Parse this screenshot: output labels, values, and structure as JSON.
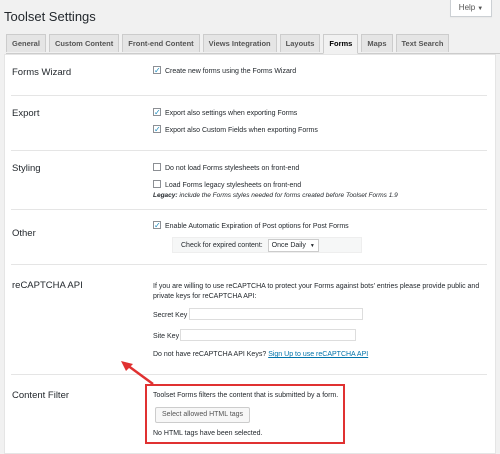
{
  "help": {
    "label": "Help"
  },
  "page": {
    "title": "Toolset Settings"
  },
  "tabs": [
    {
      "label": "General"
    },
    {
      "label": "Custom Content"
    },
    {
      "label": "Front-end Content"
    },
    {
      "label": "Views Integration"
    },
    {
      "label": "Layouts"
    },
    {
      "label": "Forms"
    },
    {
      "label": "Maps"
    },
    {
      "label": "Text Search"
    }
  ],
  "sections": {
    "wizard": {
      "title": "Forms Wizard",
      "option": {
        "label": "Create new forms using the Forms Wizard",
        "checked": true
      }
    },
    "export": {
      "title": "Export",
      "options": [
        {
          "label": "Export also settings when exporting Forms",
          "checked": true
        },
        {
          "label": "Export also Custom Fields when exporting Forms",
          "checked": true
        }
      ]
    },
    "styling": {
      "title": "Styling",
      "options": [
        {
          "label": "Do not load Forms stylesheets on front-end",
          "checked": false
        },
        {
          "label": "Load Forms legacy stylesheets on front-end",
          "checked": false
        }
      ],
      "legacy_label": "Legacy:",
      "legacy_text": "include the Forms styles needed for forms created before Toolset Forms 1.9"
    },
    "other": {
      "title": "Other",
      "option": {
        "label": "Enable Automatic Expiration of Post options for Post Forms",
        "checked": true
      },
      "check_label": "Check for expired content:",
      "check_value": "Once Daily"
    },
    "recaptcha": {
      "title": "reCAPTCHA API",
      "description_line1": "If you are willing to use reCAPTCHA to protect your Forms against bots' entries please provide public and",
      "description_line2": "private keys for reCAPTCHA API:",
      "secret_key_label": "Secret Key",
      "site_key_label": "Site Key",
      "no_keys_text": "Do not have reCAPTCHA API Keys?",
      "signup_link": "Sign Up to use reCAPTCHA API"
    },
    "content_filter": {
      "title": "Content Filter",
      "description": "Toolset Forms filters the content that is submitted by a form.",
      "button_label": "Select allowed HTML tags",
      "status": "No HTML tags have been selected."
    }
  },
  "colors": {
    "accent": "#0073aa",
    "highlight": "#e03131"
  }
}
